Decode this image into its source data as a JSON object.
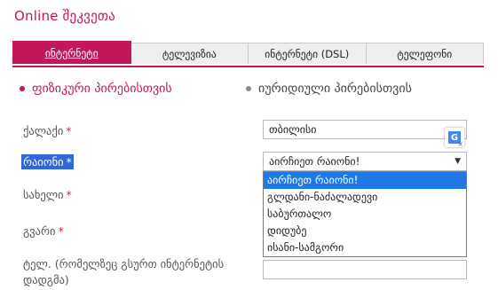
{
  "header": {
    "title": "Online შეკვეთა"
  },
  "tabs": [
    {
      "label": "ინტერნეტი",
      "active": true
    },
    {
      "label": "ტელევიზია",
      "active": false
    },
    {
      "label": "ინტერნეტი (DSL)",
      "active": false
    },
    {
      "label": "ტელეფონი",
      "active": false
    }
  ],
  "customer_type": {
    "options": [
      {
        "label": "ფიზიკური პირებისთვის",
        "selected": true
      },
      {
        "label": "იურიდიული პირებისთვის",
        "selected": false
      }
    ]
  },
  "form": {
    "required_mark": "*",
    "city": {
      "label": "ქალაქი",
      "value": "თბილისი"
    },
    "district": {
      "label": "რაიონი",
      "value": "აირჩიეთ რაიონი!",
      "options": [
        "აირჩიეთ რაიონი!",
        "გლდანი-ნაძალადევი",
        "საბურთალო",
        "დიდუბე",
        "ისანი-სამგორი"
      ],
      "highlighted_option": 0
    },
    "first_name": {
      "label": "სახელი"
    },
    "last_name": {
      "label": "გვარი"
    },
    "phone": {
      "label": "ტელ. (რომელზეც გსურთ ინტერნეტის დადგმა)"
    }
  },
  "translate_badge": {
    "letter": "G",
    "close": "×"
  },
  "colors": {
    "accent": "#c2185b",
    "selection": "#1e78e6",
    "label_highlight": "#3367d6"
  }
}
